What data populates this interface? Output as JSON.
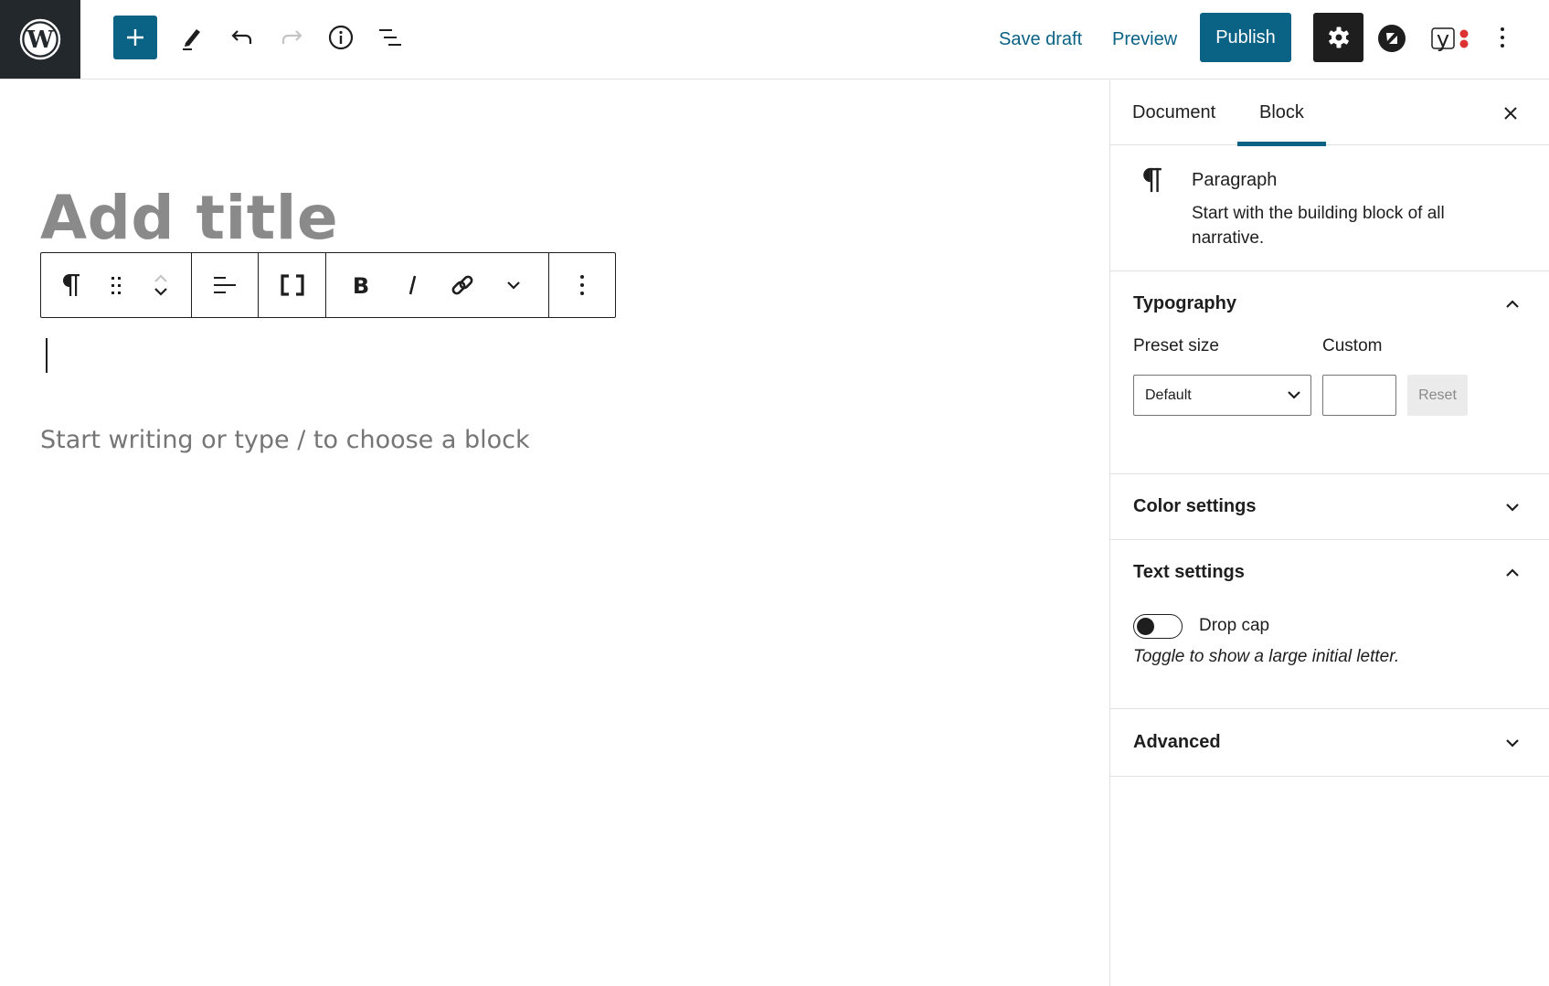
{
  "header": {
    "logo": "wordpress-logo",
    "icons": [
      "plus-icon",
      "pencil-icon",
      "undo-icon",
      "redo-icon",
      "info-icon",
      "list-view-icon",
      "gear-icon",
      "jetpack-icon",
      "yoast-icon",
      "more-vertical-icon"
    ],
    "save_draft": "Save draft",
    "preview": "Preview",
    "publish": "Publish",
    "redo_disabled": true
  },
  "editor": {
    "title_placeholder": "Add title",
    "block_placeholder": "Start writing or type / to choose a block",
    "toolbar": {
      "groups": [
        [
          "paragraph-icon",
          "drag-handle-icon",
          "move-up-down-icon"
        ],
        [
          "align-left-icon"
        ],
        [
          "fullwidth-brackets-icon"
        ],
        [
          "bold-icon",
          "italic-icon",
          "link-icon",
          "chevron-down-icon"
        ],
        [
          "more-vertical-icon"
        ]
      ]
    }
  },
  "sidebar": {
    "tabs": [
      {
        "label": "Document",
        "active": false
      },
      {
        "label": "Block",
        "active": true
      }
    ],
    "block": {
      "name": "Paragraph",
      "description": "Start with the building block of all narrative."
    },
    "typography": {
      "title": "Typography",
      "expanded": true,
      "preset_label": "Preset size",
      "preset_value": "Default",
      "custom_label": "Custom",
      "custom_value": "",
      "reset_label": "Reset"
    },
    "color_settings": {
      "title": "Color settings",
      "expanded": false
    },
    "text_settings": {
      "title": "Text settings",
      "expanded": true,
      "drop_cap_label": "Drop cap",
      "drop_cap_on": false,
      "help": "Toggle to show a large initial letter."
    },
    "advanced": {
      "title": "Advanced",
      "expanded": false
    }
  },
  "colors": {
    "accent": "#0a6285",
    "dark": "#1e1e1e",
    "logo_bg": "#23282d",
    "title_placeholder": "#8a8a8a",
    "yoast_dot": "#dc3232"
  }
}
